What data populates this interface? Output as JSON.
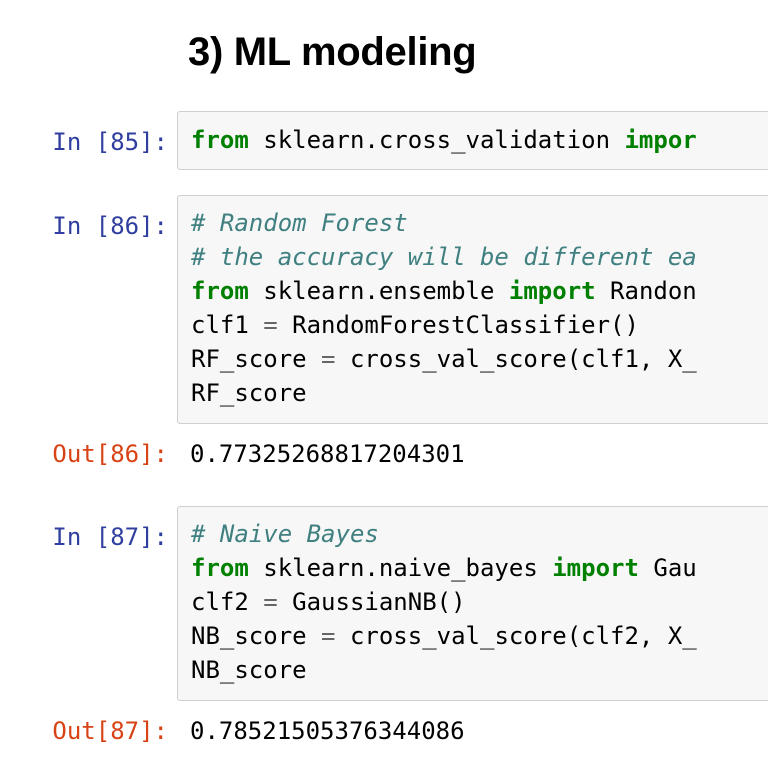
{
  "heading": "3) ML modeling",
  "cells": [
    {
      "prompt": "In [85]:",
      "lines": [
        [
          {
            "t": "from",
            "c": "kw"
          },
          {
            "t": " sklearn.cross_validation ",
            "c": ""
          },
          {
            "t": "impor",
            "c": "kw"
          }
        ]
      ]
    },
    {
      "prompt": "In [86]:",
      "lines": [
        [
          {
            "t": "# Random Forest",
            "c": "cm"
          }
        ],
        [
          {
            "t": "# the accuracy will be different ea",
            "c": "cm"
          }
        ],
        [
          {
            "t": "from",
            "c": "kw"
          },
          {
            "t": " sklearn.ensemble ",
            "c": ""
          },
          {
            "t": "import",
            "c": "kw"
          },
          {
            "t": " Randon",
            "c": ""
          }
        ],
        [
          {
            "t": "clf1 ",
            "c": ""
          },
          {
            "t": "=",
            "c": "op"
          },
          {
            "t": " RandomForestClassifier()",
            "c": ""
          }
        ],
        [
          {
            "t": "RF_score ",
            "c": ""
          },
          {
            "t": "=",
            "c": "op"
          },
          {
            "t": " cross_val_score(clf1, X_",
            "c": ""
          }
        ],
        [
          {
            "t": "RF_score",
            "c": ""
          }
        ]
      ],
      "out_prompt": "Out[86]:",
      "output": "0.77325268817204301"
    },
    {
      "prompt": "In [87]:",
      "lines": [
        [
          {
            "t": "# Naive Bayes",
            "c": "cm"
          }
        ],
        [
          {
            "t": "from",
            "c": "kw"
          },
          {
            "t": " sklearn.naive_bayes ",
            "c": ""
          },
          {
            "t": "import",
            "c": "kw"
          },
          {
            "t": " Gau",
            "c": ""
          }
        ],
        [
          {
            "t": "clf2 ",
            "c": ""
          },
          {
            "t": "=",
            "c": "op"
          },
          {
            "t": " GaussianNB()",
            "c": ""
          }
        ],
        [
          {
            "t": "NB_score ",
            "c": ""
          },
          {
            "t": "=",
            "c": "op"
          },
          {
            "t": " cross_val_score(clf2, X_",
            "c": ""
          }
        ],
        [
          {
            "t": "NB_score",
            "c": ""
          }
        ]
      ],
      "out_prompt": "Out[87]:",
      "output": "0.78521505376344086"
    }
  ]
}
